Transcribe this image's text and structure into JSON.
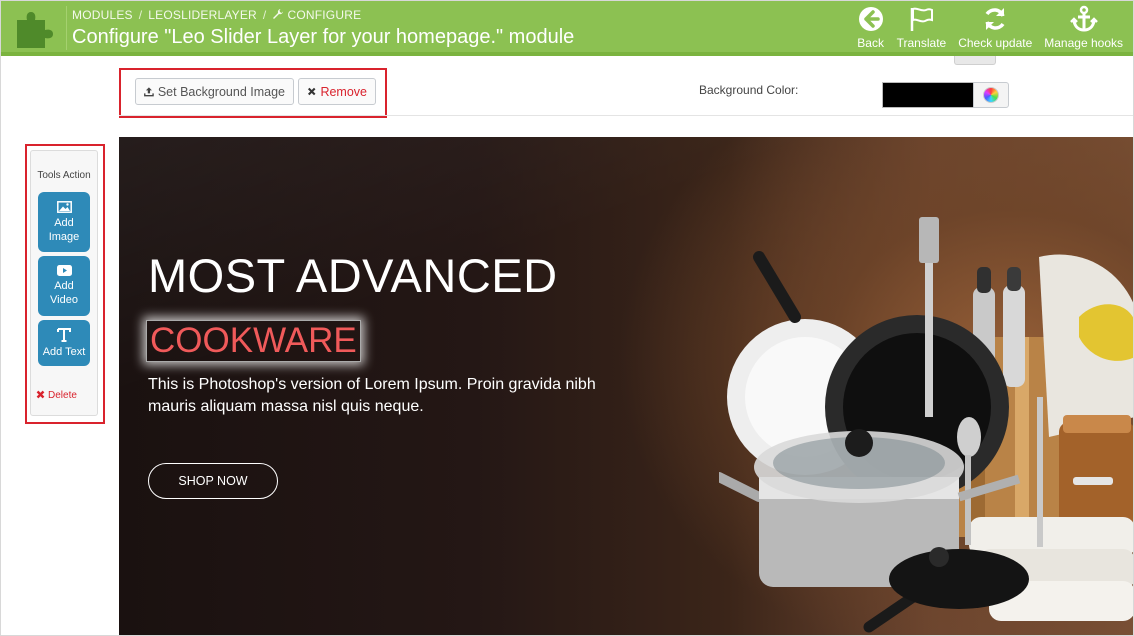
{
  "header": {
    "breadcrumb": [
      "MODULES",
      "LEOSLIDERLAYER",
      "CONFIGURE"
    ],
    "separator": "/",
    "title": "Configure \"Leo Slider Layer for your homepage.\" module",
    "toolbar": [
      {
        "label": "Back",
        "icon": "arrow-left-circle-icon"
      },
      {
        "label": "Translate",
        "icon": "flag-icon"
      },
      {
        "label": "Check update",
        "icon": "refresh-icon"
      },
      {
        "label": "Manage hooks",
        "icon": "anchor-icon"
      }
    ],
    "colors": {
      "bar": "#8cc152",
      "accent": "#7bb33f"
    }
  },
  "controls": {
    "set_background_label": "Set Background Image",
    "remove_label": "Remove",
    "background_color_label": "Background Color:",
    "background_color_value": "#000000",
    "remove_color": "#d9232d"
  },
  "tools": {
    "title": "Tools Action",
    "add_image": [
      "Add",
      "Image"
    ],
    "add_video": [
      "Add",
      "Video"
    ],
    "add_text": "Add Text",
    "delete_label": "Delete",
    "button_color": "#2e8ab8"
  },
  "slide": {
    "headline": "MOST ADVANCED",
    "subheadline": "COOKWARE",
    "body": "This is Photoshop's version of Lorem Ipsum. Proin gravida nibh mauris aliquam massa nisl quis neque.",
    "cta": "SHOP NOW",
    "subheadline_color": "#f05a5a",
    "image": "cookware-product-photo"
  }
}
